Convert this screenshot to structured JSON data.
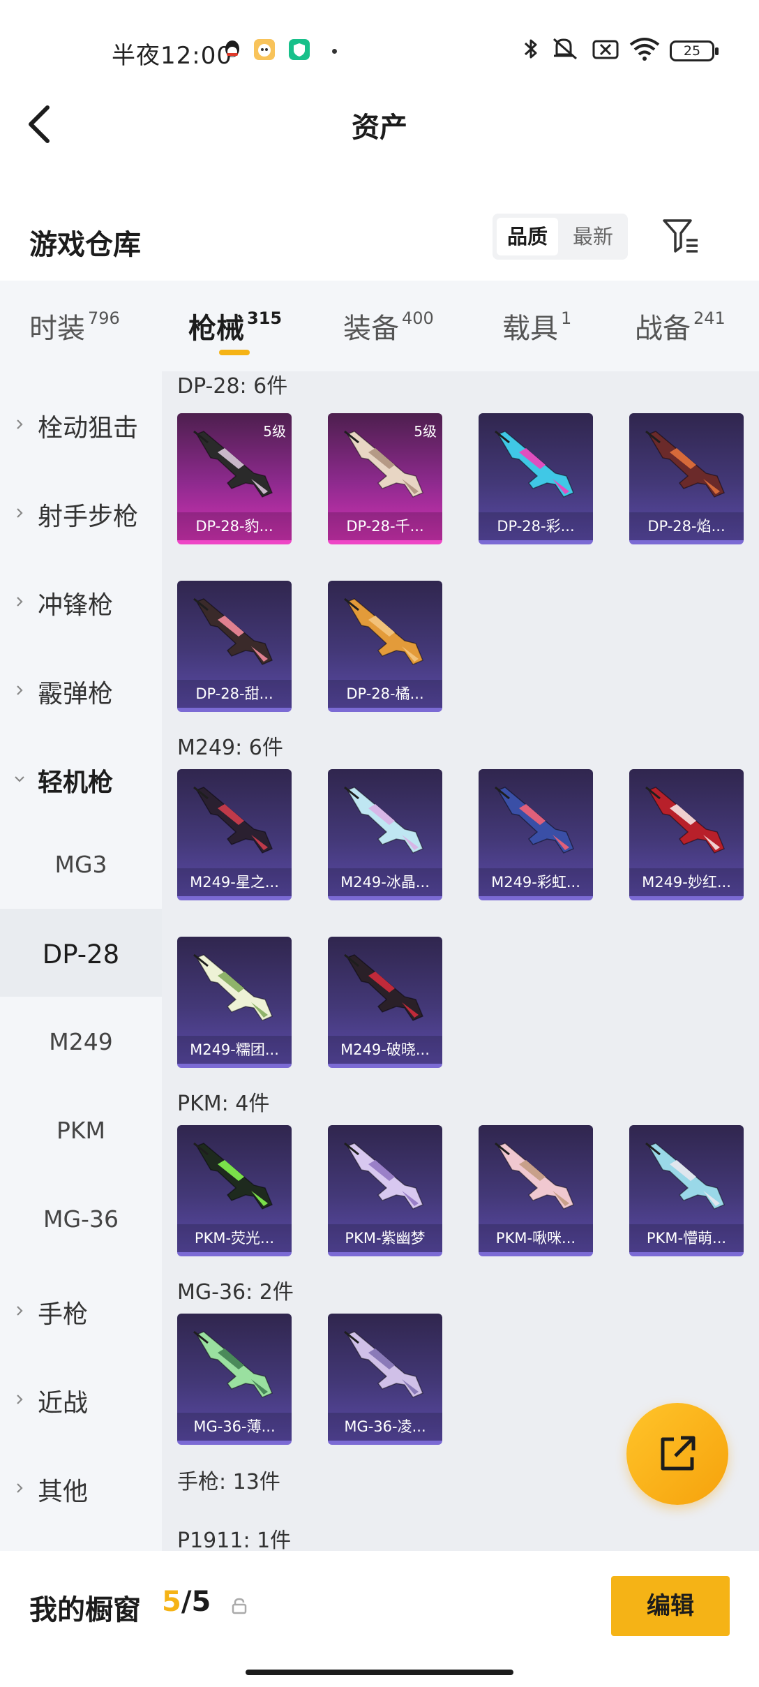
{
  "status_bar": {
    "time": "半夜12:00",
    "battery": "25",
    "icons": [
      "qq-icon",
      "app-icon",
      "shield-app-icon",
      "bluetooth-icon",
      "mute-icon",
      "sim-off-icon",
      "wifi-icon",
      "battery-icon"
    ]
  },
  "header": {
    "title": "资产"
  },
  "warehouse": {
    "title": "游戏仓库",
    "sort_quality": "品质",
    "sort_newest": "最新"
  },
  "tabs": [
    {
      "label": "时装",
      "count": "796"
    },
    {
      "label": "枪械",
      "count": "315",
      "active": true
    },
    {
      "label": "装备",
      "count": "400"
    },
    {
      "label": "载具",
      "count": "1"
    },
    {
      "label": "战备",
      "count": "241"
    }
  ],
  "sidebar": [
    {
      "label": "栓动狙击",
      "type": "parent"
    },
    {
      "label": "射手步枪",
      "type": "parent"
    },
    {
      "label": "冲锋枪",
      "type": "parent"
    },
    {
      "label": "霰弹枪",
      "type": "parent"
    },
    {
      "label": "轻机枪",
      "type": "parent",
      "open": true
    },
    {
      "label": "MG3",
      "type": "child"
    },
    {
      "label": "DP-28",
      "type": "child",
      "selected": true
    },
    {
      "label": "M249",
      "type": "child"
    },
    {
      "label": "PKM",
      "type": "child"
    },
    {
      "label": "MG-36",
      "type": "child"
    },
    {
      "label": "手枪",
      "type": "parent"
    },
    {
      "label": "近战",
      "type": "parent"
    },
    {
      "label": "其他",
      "type": "parent"
    }
  ],
  "groups": [
    {
      "label": "DP-28: 6件",
      "items": [
        {
          "name": "DP-28-豹...",
          "level": "5级",
          "rarity": "pink",
          "colors": [
            "#2a2a2a",
            "#c9b7c9"
          ]
        },
        {
          "name": "DP-28-千...",
          "level": "5级",
          "rarity": "pink",
          "colors": [
            "#e8d6c4",
            "#b59a86"
          ]
        },
        {
          "name": "DP-28-彩...",
          "rarity": "purple",
          "colors": [
            "#40c8e6",
            "#e04fbf"
          ]
        },
        {
          "name": "DP-28-焰...",
          "rarity": "purple",
          "colors": [
            "#6b2a2a",
            "#d66a3a"
          ]
        },
        {
          "name": "DP-28-甜...",
          "rarity": "purple",
          "colors": [
            "#3a2a2a",
            "#e08090"
          ]
        },
        {
          "name": "DP-28-橘...",
          "rarity": "purple",
          "colors": [
            "#e39b3a",
            "#f2c27a"
          ]
        }
      ]
    },
    {
      "label": "M249: 6件",
      "items": [
        {
          "name": "M249-星之...",
          "rarity": "purple",
          "colors": [
            "#2a2030",
            "#c03a4a"
          ]
        },
        {
          "name": "M249-冰晶...",
          "rarity": "purple",
          "colors": [
            "#bfe6f2",
            "#d7b6e6"
          ]
        },
        {
          "name": "M249-彩虹...",
          "rarity": "purple",
          "colors": [
            "#3a4fa6",
            "#e0607a"
          ]
        },
        {
          "name": "M249-妙红...",
          "rarity": "purple",
          "colors": [
            "#b8202a",
            "#f0d0d0"
          ]
        },
        {
          "name": "M249-糯团...",
          "rarity": "purple",
          "colors": [
            "#eef2d6",
            "#8fb36a"
          ]
        },
        {
          "name": "M249-破晓...",
          "rarity": "purple",
          "colors": [
            "#2a2028",
            "#c02a3a"
          ]
        }
      ]
    },
    {
      "label": "PKM: 4件",
      "items": [
        {
          "name": "PKM-荧光...",
          "rarity": "purple",
          "colors": [
            "#1e2a1e",
            "#7ae04a"
          ]
        },
        {
          "name": "PKM-紫幽梦",
          "rarity": "purple",
          "colors": [
            "#d8c8f0",
            "#9a80c8"
          ]
        },
        {
          "name": "PKM-啾咪...",
          "rarity": "purple",
          "colors": [
            "#f0c8d0",
            "#c8a08a"
          ]
        },
        {
          "name": "PKM-懵萌...",
          "rarity": "purple",
          "colors": [
            "#9ad8e8",
            "#e0e6ee"
          ]
        }
      ]
    },
    {
      "label": "MG-36: 2件",
      "items": [
        {
          "name": "MG-36-薄...",
          "rarity": "purple",
          "colors": [
            "#9ae0a0",
            "#4a8a5a"
          ]
        },
        {
          "name": "MG-36-凌...",
          "rarity": "purple",
          "colors": [
            "#d0c0e8",
            "#8a7ab8"
          ]
        }
      ]
    }
  ],
  "extra_labels": [
    "手枪: 13件",
    "P1911: 1件"
  ],
  "bottom": {
    "title": "我的橱窗",
    "current": "5",
    "separator": "/",
    "total": "5",
    "edit": "编辑"
  },
  "theme": {
    "accent": "#f5b316",
    "purple_rarity": "#7b6ad4",
    "pink_rarity": "#ee46c6"
  }
}
